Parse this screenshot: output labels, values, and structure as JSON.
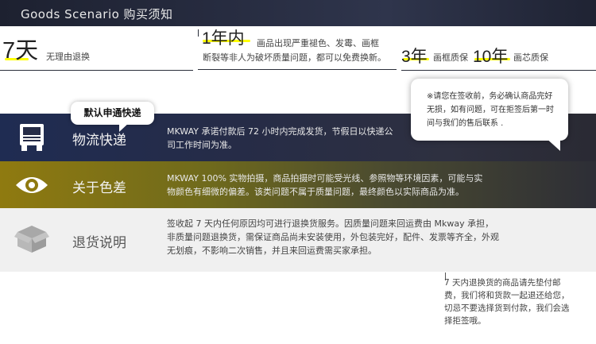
{
  "header": {
    "title": "Goods Scenario 购买须知"
  },
  "guarantees": [
    {
      "big": "7天",
      "small": "无理由退换"
    },
    {
      "big": "1年内",
      "small_lines": [
        "画品出现严重褪色、发霉、画框",
        "断裂等非人为破坏质量问题，都可以免费换新。"
      ]
    },
    {
      "big": "3年",
      "small": "画框质保"
    },
    {
      "big": "10年",
      "small": "画芯质保"
    }
  ],
  "bubbles": {
    "notice": "※请您在签收前，务必确认商品完好无损，如有问题，可在拒签后第一时间与我们的售后联系 .",
    "default_courier": "默认申通快递"
  },
  "sections": {
    "logistics": {
      "title": "物流快递",
      "text": "MKWAY 承诺付款后 72 小时内完成发货，节假日以快递公司工作时间为准。"
    },
    "color": {
      "title": "关于色差",
      "text": "MKWAY 100% 实物拍摄，商品拍摄时可能受光线、参照物等环境因素，可能与实物颜色有细微的偏差。该类问题不属于质量问题，最终颜色以实际商品为准。"
    },
    "return": {
      "title": "退货说明",
      "text": "签收起 7 天内任何原因均可进行退换货服务。因质量问题来回运费由 Mkway 承担，非质量问题退换货，需保证商品尚未安装使用，外包装完好，配件、发票等齐全，外观无划痕，不影响二次销售，并且来回运费需买家承担。"
    }
  },
  "note": "7 天内退换货的商品请先垫付邮费，我们将和货款一起退还给您，切忌不要选择货到付款，我们会选择拒签哦。",
  "icons": {
    "logistics": "truck-icon",
    "color": "eye-icon",
    "return": "box-icon"
  },
  "colors": {
    "highlight": "#ffff00",
    "header": "#262b3f",
    "logistics_band": "#262c47",
    "color_band": "#8f7a10",
    "return_band": "#f0f0f0"
  }
}
